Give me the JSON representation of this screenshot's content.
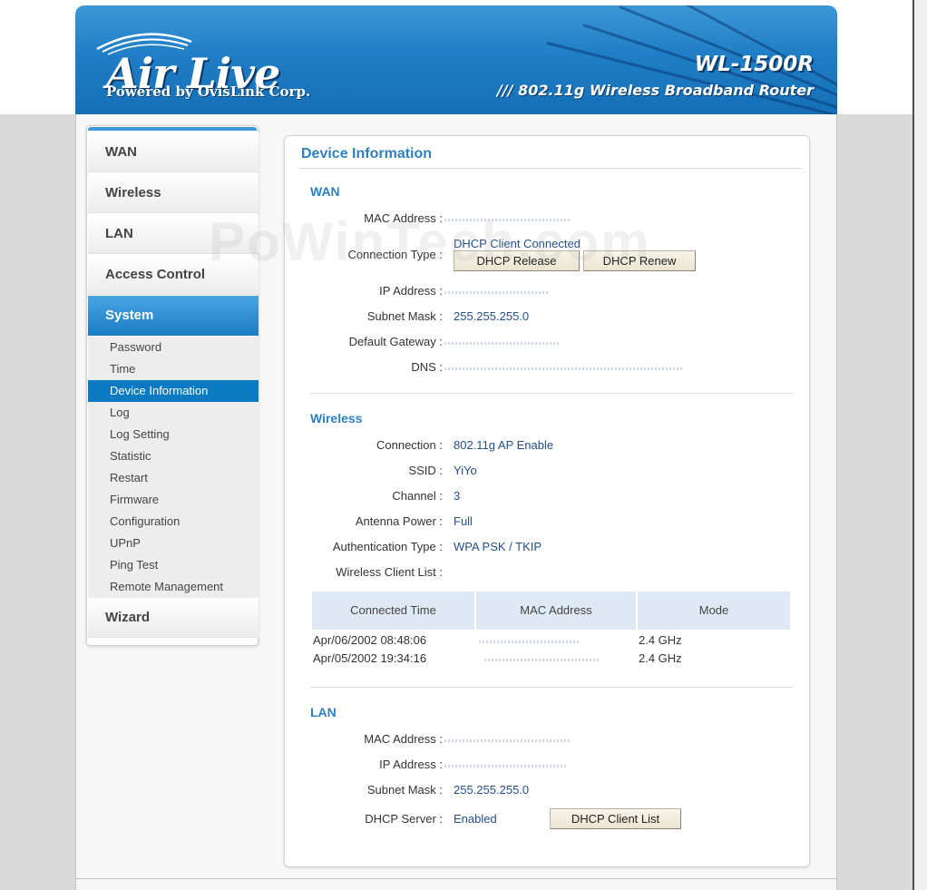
{
  "header": {
    "logo": "Air Live",
    "logo_sub": "Powered by OvisLink Corp.",
    "model": "WL-1500R",
    "model_sub": "/// 802.11g Wireless Broadband Router"
  },
  "sidebar": {
    "main_items": [
      {
        "label": "WAN"
      },
      {
        "label": "Wireless"
      },
      {
        "label": "LAN"
      },
      {
        "label": "Access Control"
      },
      {
        "label": "System"
      },
      {
        "label": "Wizard"
      }
    ],
    "active_main": "System",
    "sub_items": [
      {
        "label": "Password"
      },
      {
        "label": "Time"
      },
      {
        "label": "Device Information"
      },
      {
        "label": "Log"
      },
      {
        "label": "Log Setting"
      },
      {
        "label": "Statistic"
      },
      {
        "label": "Restart"
      },
      {
        "label": "Firmware"
      },
      {
        "label": "Configuration"
      },
      {
        "label": "UPnP"
      },
      {
        "label": "Ping Test"
      },
      {
        "label": "Remote Management"
      }
    ],
    "active_sub": "Device Information"
  },
  "content": {
    "title": "Device Information",
    "wan": {
      "heading": "WAN",
      "mac_label": "MAC Address :",
      "conn_type_label": "Connection Type :",
      "conn_type_value": "DHCP Client Connected",
      "dhcp_release_label": "DHCP Release",
      "dhcp_renew_label": "DHCP Renew",
      "ip_label": "IP Address :",
      "subnet_label": "Subnet Mask :",
      "subnet_value": "255.255.255.0",
      "gateway_label": "Default Gateway :",
      "dns_label": "DNS :"
    },
    "wireless": {
      "heading": "Wireless",
      "connection_label": "Connection :",
      "connection_value": "802.11g AP Enable",
      "ssid_label": "SSID :",
      "ssid_value": "YiYo",
      "channel_label": "Channel :",
      "channel_value": "3",
      "antenna_label": "Antenna Power :",
      "antenna_value": "Full",
      "auth_label": "Authentication Type :",
      "auth_value": "WPA PSK / TKIP",
      "client_list_label": "Wireless Client List :",
      "table": {
        "columns": [
          "Connected Time",
          "MAC Address",
          "Mode"
        ],
        "rows": [
          {
            "time": "Apr/06/2002 08:48:06",
            "mode": "2.4 GHz"
          },
          {
            "time": "Apr/05/2002 19:34:16",
            "mode": "2.4 GHz"
          }
        ]
      }
    },
    "lan": {
      "heading": "LAN",
      "mac_label": "MAC Address :",
      "ip_label": "IP Address :",
      "subnet_label": "Subnet Mask :",
      "subnet_value": "255.255.255.0",
      "dhcp_label": "DHCP Server :",
      "dhcp_value": "Enabled",
      "client_list_button": "DHCP Client List"
    }
  },
  "watermark": "PoWinTech.com",
  "colors": {
    "brand_blue": "#1f7ec5",
    "section_blue": "#2f7fc1",
    "value_blue": "#234f8c",
    "active_sub": "#0a7ac3"
  }
}
